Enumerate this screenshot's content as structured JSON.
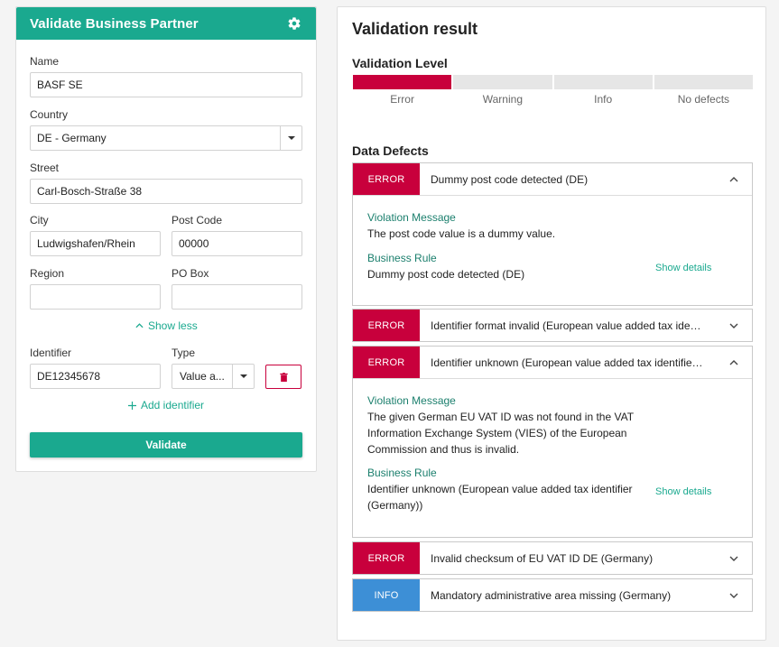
{
  "form": {
    "title": "Validate Business Partner",
    "name_label": "Name",
    "name_value": "BASF SE",
    "country_label": "Country",
    "country_value": "DE - Germany",
    "street_label": "Street",
    "street_value": "Carl-Bosch-Straße 38",
    "city_label": "City",
    "city_value": "Ludwigshafen/Rhein",
    "postcode_label": "Post Code",
    "postcode_value": "00000",
    "region_label": "Region",
    "region_value": "",
    "pobox_label": "PO Box",
    "pobox_value": "",
    "show_less": "Show less",
    "identifier_label": "Identifier",
    "identifier_value": "DE12345678",
    "type_label": "Type",
    "type_value": "Value a...",
    "add_identifier": "Add identifier",
    "validate_button": "Validate"
  },
  "result": {
    "title": "Validation result",
    "level_heading": "Validation Level",
    "levels": [
      "Error",
      "Warning",
      "Info",
      "No defects"
    ],
    "active_level_index": 0,
    "defects_heading": "Data Defects",
    "violation_label": "Violation Message",
    "rule_label": "Business Rule",
    "show_details": "Show details",
    "defects": [
      {
        "severity": "ERROR",
        "title": "Dummy post code detected (DE)",
        "expanded": true,
        "message": "The post code value is a dummy value.",
        "rule": "Dummy post code detected (DE)"
      },
      {
        "severity": "ERROR",
        "title": "Identifier format invalid (European value added tax identifi...",
        "expanded": false
      },
      {
        "severity": "ERROR",
        "title": "Identifier unknown (European value added tax identifier (G...",
        "expanded": true,
        "message_lines": [
          "The given German EU VAT ID was not found in the VAT",
          "Information Exchange System (VIES) of the European",
          "Commission and thus is invalid."
        ],
        "rule_lines": [
          "Identifier unknown (European value added tax identifier",
          "(Germany))"
        ]
      },
      {
        "severity": "ERROR",
        "title": "Invalid checksum of EU VAT ID DE (Germany)",
        "expanded": false
      },
      {
        "severity": "INFO",
        "title": "Mandatory administrative area missing (Germany)",
        "expanded": false
      }
    ]
  },
  "colors": {
    "brand": "#1aa98f",
    "error": "#c8003c",
    "info": "#3d8fd6"
  },
  "icons": {
    "settings": "gear-icon",
    "delete": "trash-icon",
    "add": "plus-icon",
    "collapse": "chevron-up-icon",
    "expand": "chevron-down-icon"
  }
}
